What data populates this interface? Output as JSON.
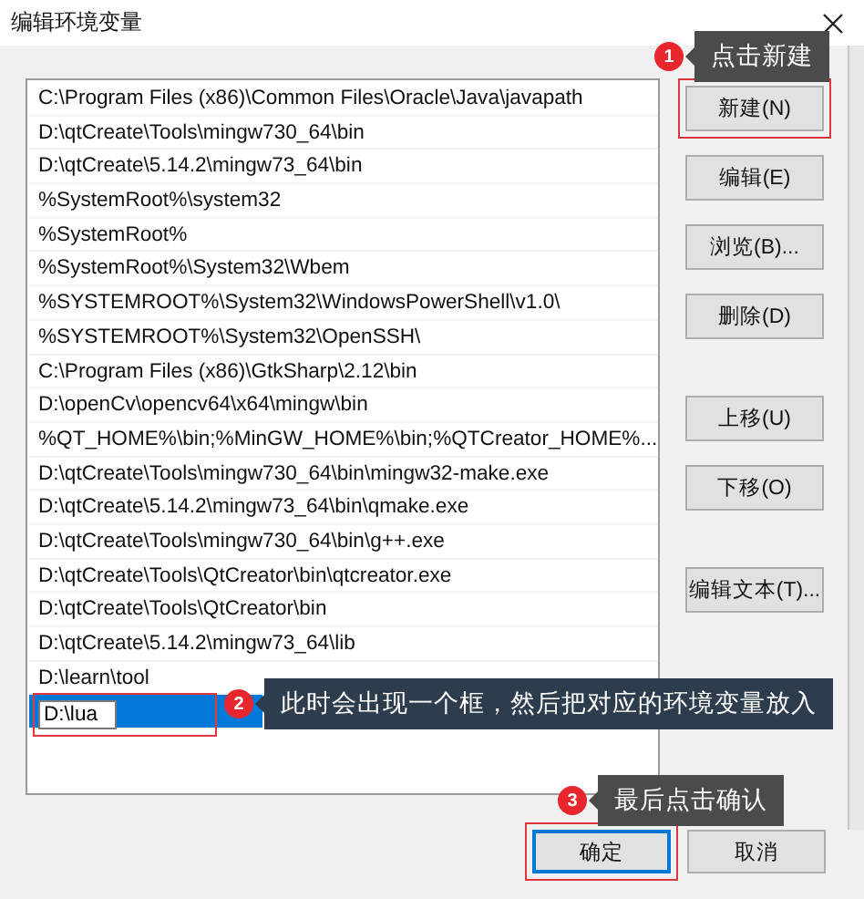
{
  "window": {
    "title": "编辑环境变量"
  },
  "entries": [
    {
      "kind": "text",
      "text": "C:\\Program Files (x86)\\Common Files\\Oracle\\Java\\javapath",
      "selected": false
    },
    {
      "kind": "text",
      "text": "D:\\qtCreate\\Tools\\mingw730_64\\bin",
      "selected": false
    },
    {
      "kind": "text",
      "text": "D:\\qtCreate\\5.14.2\\mingw73_64\\bin",
      "selected": false
    },
    {
      "kind": "text",
      "text": "%SystemRoot%\\system32",
      "selected": false
    },
    {
      "kind": "text",
      "text": "%SystemRoot%",
      "selected": false
    },
    {
      "kind": "text",
      "text": "%SystemRoot%\\System32\\Wbem",
      "selected": false
    },
    {
      "kind": "text",
      "text": "%SYSTEMROOT%\\System32\\WindowsPowerShell\\v1.0\\",
      "selected": false
    },
    {
      "kind": "text",
      "text": "%SYSTEMROOT%\\System32\\OpenSSH\\",
      "selected": false
    },
    {
      "kind": "text",
      "text": "C:\\Program Files (x86)\\GtkSharp\\2.12\\bin",
      "selected": false
    },
    {
      "kind": "text",
      "text": "D:\\openCv\\opencv64\\x64\\mingw\\bin",
      "selected": false
    },
    {
      "kind": "text",
      "text": "%QT_HOME%\\bin;%MinGW_HOME%\\bin;%QTCreator_HOME%...",
      "selected": false
    },
    {
      "kind": "text",
      "text": "D:\\qtCreate\\Tools\\mingw730_64\\bin\\mingw32-make.exe",
      "selected": false
    },
    {
      "kind": "text",
      "text": "D:\\qtCreate\\5.14.2\\mingw73_64\\bin\\qmake.exe",
      "selected": false
    },
    {
      "kind": "text",
      "text": "D:\\qtCreate\\Tools\\mingw730_64\\bin\\g++.exe",
      "selected": false
    },
    {
      "kind": "text",
      "text": "D:\\qtCreate\\Tools\\QtCreator\\bin\\qtcreator.exe",
      "selected": false
    },
    {
      "kind": "text",
      "text": "D:\\qtCreate\\Tools\\QtCreator\\bin",
      "selected": false
    },
    {
      "kind": "text",
      "text": "D:\\qtCreate\\5.14.2\\mingw73_64\\lib",
      "selected": false
    },
    {
      "kind": "text",
      "text": "D:\\learn\\tool",
      "selected": false
    },
    {
      "kind": "editing",
      "text": "D:\\lua",
      "selected": true
    }
  ],
  "side_buttons": [
    {
      "label": "新建(N)",
      "highlighted": true
    },
    {
      "label": "编辑(E)",
      "highlighted": false
    },
    {
      "label": "浏览(B)...",
      "highlighted": false
    },
    {
      "label": "删除(D)",
      "highlighted": false
    },
    {
      "label": "上移(U)",
      "highlighted": false
    },
    {
      "label": "下移(O)",
      "highlighted": false
    },
    {
      "label": "编辑文本(T)...",
      "highlighted": false
    }
  ],
  "footer_buttons": [
    {
      "label": "确定",
      "default": true,
      "highlighted": true
    },
    {
      "label": "取消",
      "default": false,
      "highlighted": false
    }
  ],
  "callouts": [
    {
      "number": "1",
      "text": "点击新建"
    },
    {
      "number": "2",
      "text": "此时会出现一个框，然后把对应的环境变量放入"
    },
    {
      "number": "3",
      "text": "最后点击确认"
    }
  ]
}
